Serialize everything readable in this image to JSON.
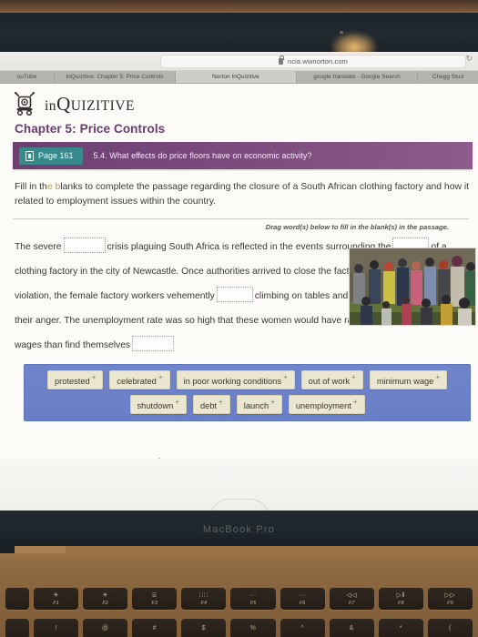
{
  "browser": {
    "url": "ncia.wwnorton.com",
    "lock_icon": "lock-icon",
    "reload_icon": "reload-icon",
    "reload_glyph": "↻",
    "tabs": [
      {
        "label": "ouTube",
        "active": false
      },
      {
        "label": "InQuizitive: Chapter 5: Price Controls",
        "active": false
      },
      {
        "label": "Norton InQuizitive",
        "active": true
      },
      {
        "label": "google translate - Google Search",
        "active": false
      },
      {
        "label": "Chegg Stud",
        "active": false
      }
    ]
  },
  "site": {
    "logo_icon": "inquizitive-robot-logo",
    "brand_in": "in",
    "brand_q": "Q",
    "brand_uizitive": "UIZITIVE",
    "chapter_title": "Chapter 5: Price Controls"
  },
  "question_banner": {
    "page_icon": "book-icon",
    "page_label": "Page 161",
    "question": "5.4. What effects do price floors have on economic activity?",
    "banner_color": "#7a4a7c",
    "chip_color": "#38898c"
  },
  "instructions": {
    "line1_a": "Fill in th",
    "line1_hl": "e b",
    "line1_b": "lanks to complete the passage regarding the closure of a South African clothing factory",
    "line2": "and how it related to employment issues within the country."
  },
  "drag_hint": "Drag word(s) below to fill in the blank(s) in the passage.",
  "passage": {
    "seg1": "The severe",
    "seg2": "crisis plaguing South Africa is reflected in the events surrounding the",
    "seg3": "of a clothing factory in the city of Newcastle. Once authorities arrived to close the factory due to a",
    "seg4": "violation, the female factory workers vehemently",
    "seg5": "climbing on tables and cutting boards to express their anger. The unemployment rate was so high that these women would have rather been paid dismal wages than find themselves",
    "blank_count": 5
  },
  "photo_inset": {
    "alt": "crowd-of-people-photo"
  },
  "cursor": {
    "icon": "hand-cursor"
  },
  "word_bank": {
    "background_color": "#687ec6",
    "chip_color": "#eae6cf",
    "plus_glyph": "+",
    "rows": [
      [
        {
          "label": "protested"
        },
        {
          "label": "celebrated"
        },
        {
          "label": "in poor working conditions"
        },
        {
          "label": "out of work"
        },
        {
          "label": "minimum wage"
        }
      ],
      [
        {
          "label": "shutdown"
        },
        {
          "label": "debt"
        },
        {
          "label": "launch"
        },
        {
          "label": "unemployment"
        }
      ]
    ]
  },
  "hardware": {
    "model_label": "MacBook Pro",
    "function_keys": [
      {
        "glyph": "☀",
        "fn": "F1",
        "name": "brightness-down-key"
      },
      {
        "glyph": "☀",
        "fn": "F2",
        "name": "brightness-up-key"
      },
      {
        "glyph": "⌸",
        "fn": "F3",
        "name": "mission-control-key"
      },
      {
        "glyph": "∷∷",
        "fn": "F4",
        "name": "launchpad-key"
      },
      {
        "glyph": "∙∙∙",
        "fn": "F5",
        "name": "keyboard-backlight-down-key"
      },
      {
        "glyph": "∙∙∙",
        "fn": "F6",
        "name": "keyboard-backlight-up-key"
      },
      {
        "glyph": "◁◁",
        "fn": "F7",
        "name": "rewind-key"
      },
      {
        "glyph": "▷‖",
        "fn": "F8",
        "name": "play-pause-key"
      },
      {
        "glyph": "▷▷",
        "fn": "F9",
        "name": "fast-forward-key"
      }
    ],
    "number_row": [
      {
        "glyph": "!",
        "name": "key-1"
      },
      {
        "glyph": "@",
        "name": "key-2"
      },
      {
        "glyph": "#",
        "name": "key-3"
      },
      {
        "glyph": "$",
        "name": "key-4"
      },
      {
        "glyph": "%",
        "name": "key-5"
      },
      {
        "glyph": "^",
        "name": "key-6"
      },
      {
        "glyph": "&",
        "name": "key-7"
      },
      {
        "glyph": "*",
        "name": "key-8"
      },
      {
        "glyph": "(",
        "name": "key-9"
      }
    ]
  }
}
